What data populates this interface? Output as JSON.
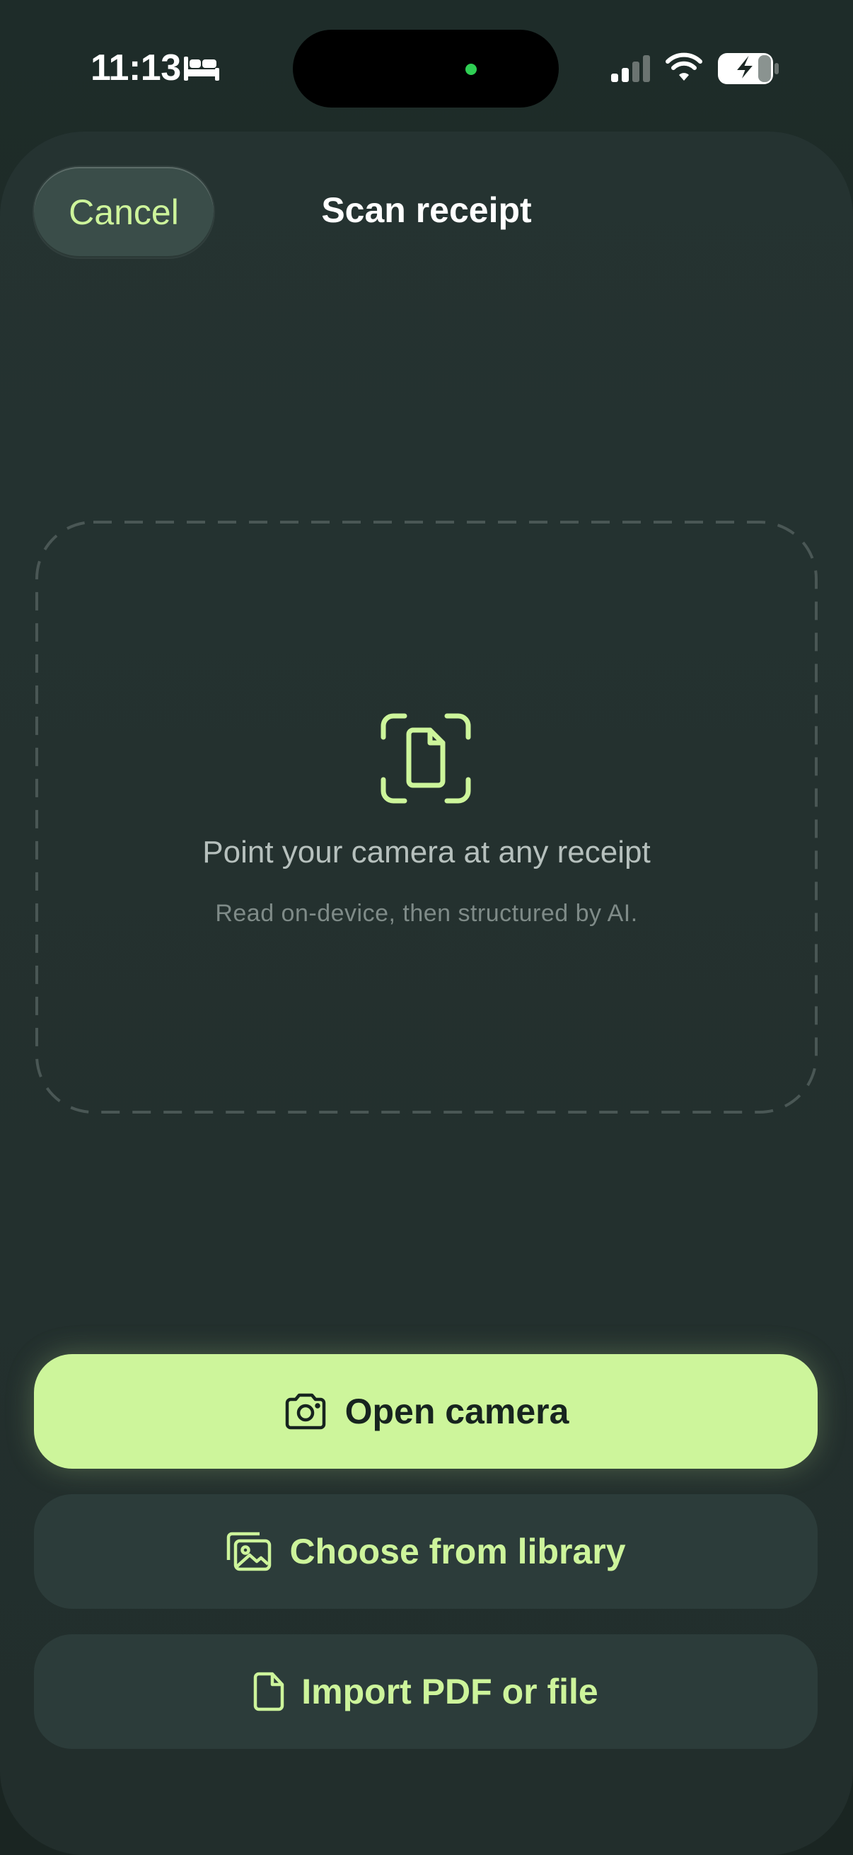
{
  "status_bar": {
    "time": "11:13",
    "icons": [
      "bed-icon",
      "cellular-signal-icon",
      "wifi-icon",
      "battery-charging-icon"
    ]
  },
  "header": {
    "cancel_label": "Cancel",
    "title": "Scan receipt"
  },
  "scan_area": {
    "icon": "document-scan-icon",
    "headline": "Point your camera at any receipt",
    "subtitle": "Read on-device, then structured by AI."
  },
  "actions": {
    "open_camera": {
      "label": "Open camera",
      "icon": "camera-icon"
    },
    "choose_library": {
      "label": "Choose from library",
      "icon": "photo-library-icon"
    },
    "import_file": {
      "label": "Import PDF or file",
      "icon": "file-icon"
    }
  },
  "colors": {
    "accent": "#cdf59b",
    "background": "#1b2724",
    "sheet": "#253331",
    "secondary_button": "#2c3c3a"
  }
}
